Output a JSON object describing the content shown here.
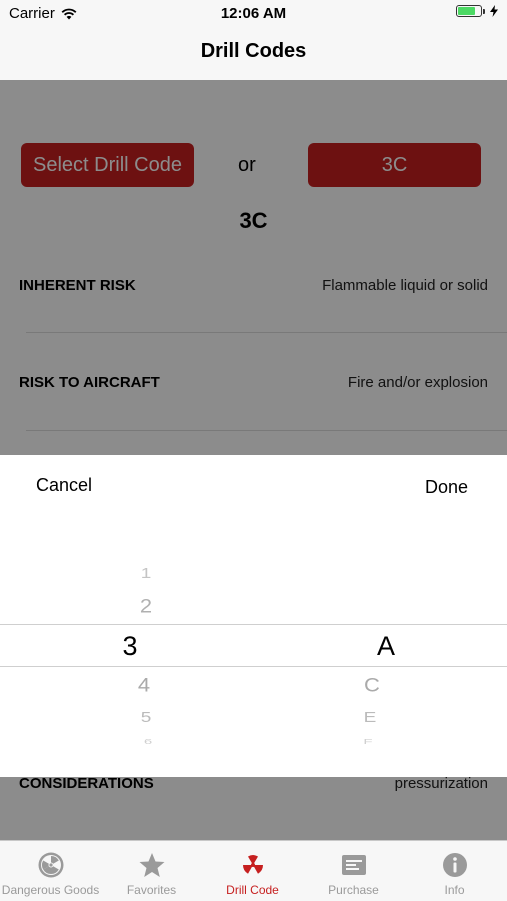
{
  "status_bar": {
    "carrier": "Carrier",
    "time": "12:06 AM"
  },
  "nav": {
    "title": "Drill Codes"
  },
  "main": {
    "select_button": "Select Drill Code",
    "or_text": "or",
    "code_button": "3C",
    "selected_code": "3C",
    "rows": [
      {
        "label": "INHERENT RISK",
        "value": "Flammable liquid or solid"
      },
      {
        "label": "RISK TO AIRCRAFT",
        "value": "Fire and/or explosion"
      },
      {
        "label": "CONSIDERATIONS",
        "value": "pressurization"
      }
    ]
  },
  "picker": {
    "cancel_label": "Cancel",
    "done_label": "Done",
    "numbers": {
      "above": [
        "1",
        "2"
      ],
      "selected": "3",
      "below": [
        "4",
        "5",
        "6"
      ]
    },
    "letters": {
      "selected": "A",
      "below": [
        "C",
        "E",
        "F"
      ]
    }
  },
  "tabbar": {
    "active_color": "#c62020",
    "items": [
      {
        "label": "Dangerous Goods",
        "icon": "radiation-icon"
      },
      {
        "label": "Favorites",
        "icon": "star-icon"
      },
      {
        "label": "Drill Code",
        "icon": "radiation-icon"
      },
      {
        "label": "Purchase",
        "icon": "receipt-icon"
      },
      {
        "label": "Info",
        "icon": "info-icon"
      }
    ]
  }
}
